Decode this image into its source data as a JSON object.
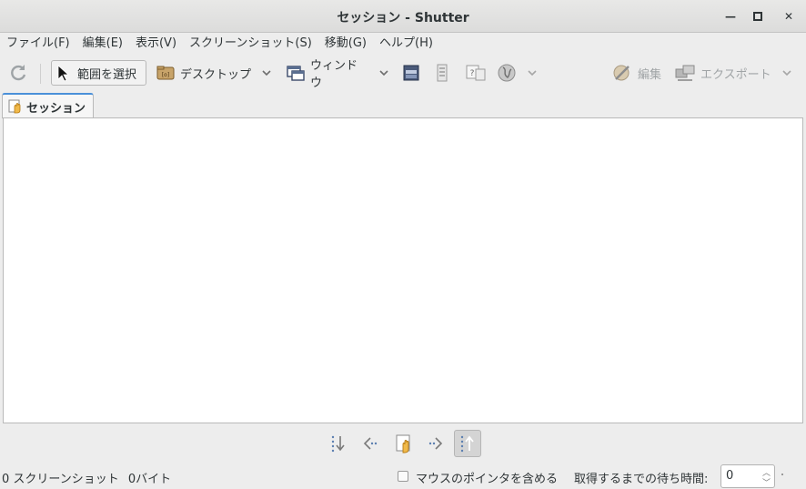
{
  "window": {
    "title": "セッション - Shutter",
    "minimize_glyph": "—",
    "maximize_glyph": "▢",
    "close_glyph": "✕"
  },
  "menubar": {
    "items": [
      "ファイル(F)",
      "編集(E)",
      "表示(V)",
      "スクリーンショット(S)",
      "移動(G)",
      "ヘルプ(H)"
    ]
  },
  "toolbar": {
    "selection_label": "範囲を選択",
    "desktop_label": "デスクトップ",
    "window_label": "ウィンドウ",
    "edit_label": "編集",
    "export_label": "エクスポート"
  },
  "tabs": [
    {
      "label": "セッション",
      "icon": "session-hand-icon"
    }
  ],
  "status": {
    "screenshot_count": "0 スクリーンショット",
    "size": "0バイト",
    "include_cursor_label": "マウスのポインタを含める",
    "include_cursor_checked": false,
    "delay_label": "取得するまでの待ち時間:",
    "delay_value": "0",
    "spin_up": "︿",
    "spin_down": "﹀"
  },
  "colors": {
    "accent": "#4a90d9",
    "window_bg": "#ededed",
    "content_bg": "#ffffff"
  }
}
